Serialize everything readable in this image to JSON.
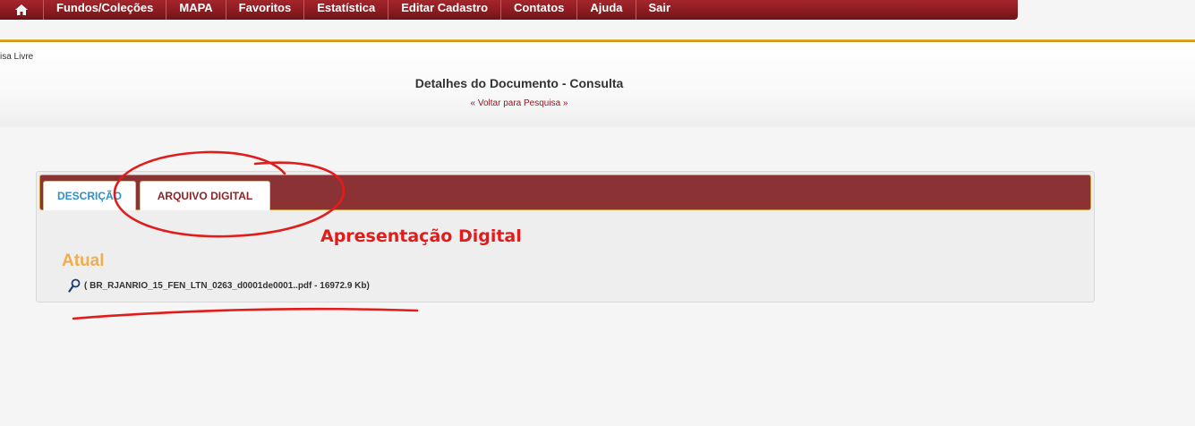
{
  "nav": {
    "home_icon": "home-icon",
    "items": [
      "Fundos/Coleções",
      "MAPA",
      "Favoritos",
      "Estatística",
      "Editar Cadastro",
      "Contatos",
      "Ajuda",
      "Sair"
    ]
  },
  "colors": {
    "nav_bg": "#8c1c22",
    "gold": "#e8b23a",
    "tab_bar": "#8b3334",
    "accent_orange": "#f0ad4e",
    "annotation_red": "#e21b1b"
  },
  "breadcrumb": "isa Livre",
  "page": {
    "title": "Detalhes do Documento - Consulta",
    "back_link": "« Voltar para Pesquisa »"
  },
  "tabs": [
    {
      "label": "DESCRIÇÃO",
      "active": false
    },
    {
      "label": "ARQUIVO DIGITAL",
      "active": true
    }
  ],
  "section": {
    "title": "Atual",
    "file_icon": "search-icon",
    "file": "( BR_RJANRIO_15_FEN_LTN_0263_d0001de0001..pdf - 16972.9 Kb)"
  },
  "annotation": {
    "text": "Apresentação Digital"
  }
}
